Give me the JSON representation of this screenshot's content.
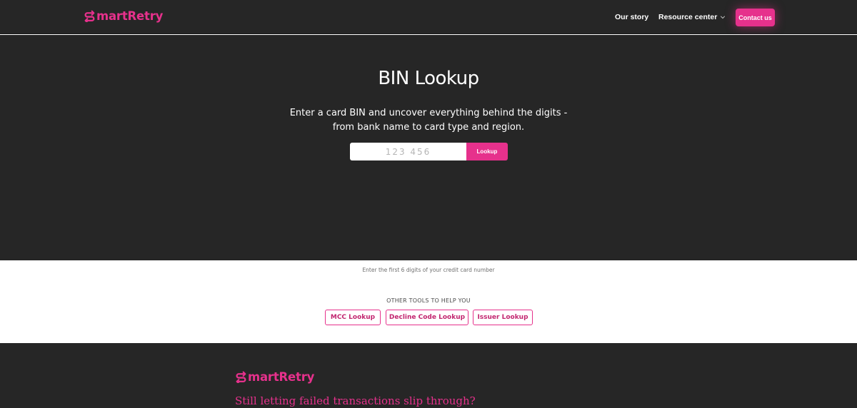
{
  "header": {
    "logo_text": "martRetry",
    "logo_mark_icon": "s-arrows-icon",
    "nav": {
      "our_story": "Our story",
      "resource_center": "Resource center"
    },
    "contact_label": "Contact us"
  },
  "hero": {
    "title": "BIN Lookup",
    "description_line1": "Enter a card BIN and uncover everything behind the digits -",
    "description_line2": "from bank name to card type and region.",
    "input_placeholder": "123 456",
    "lookup_label": "Lookup"
  },
  "tools": {
    "hint": "Enter the first 6 digits of your credit card number",
    "heading": "OTHER TOOLS TO HELP YOU",
    "buttons": [
      "MCC Lookup",
      "Decline Code Lookup",
      "Issuer Lookup"
    ]
  },
  "footer": {
    "logo_text": "martRetry",
    "tagline": "Still letting failed transactions slip through?"
  },
  "colors": {
    "brand": "#e6318c",
    "dark_bg": "#262626",
    "light_bg": "#ffffff"
  }
}
